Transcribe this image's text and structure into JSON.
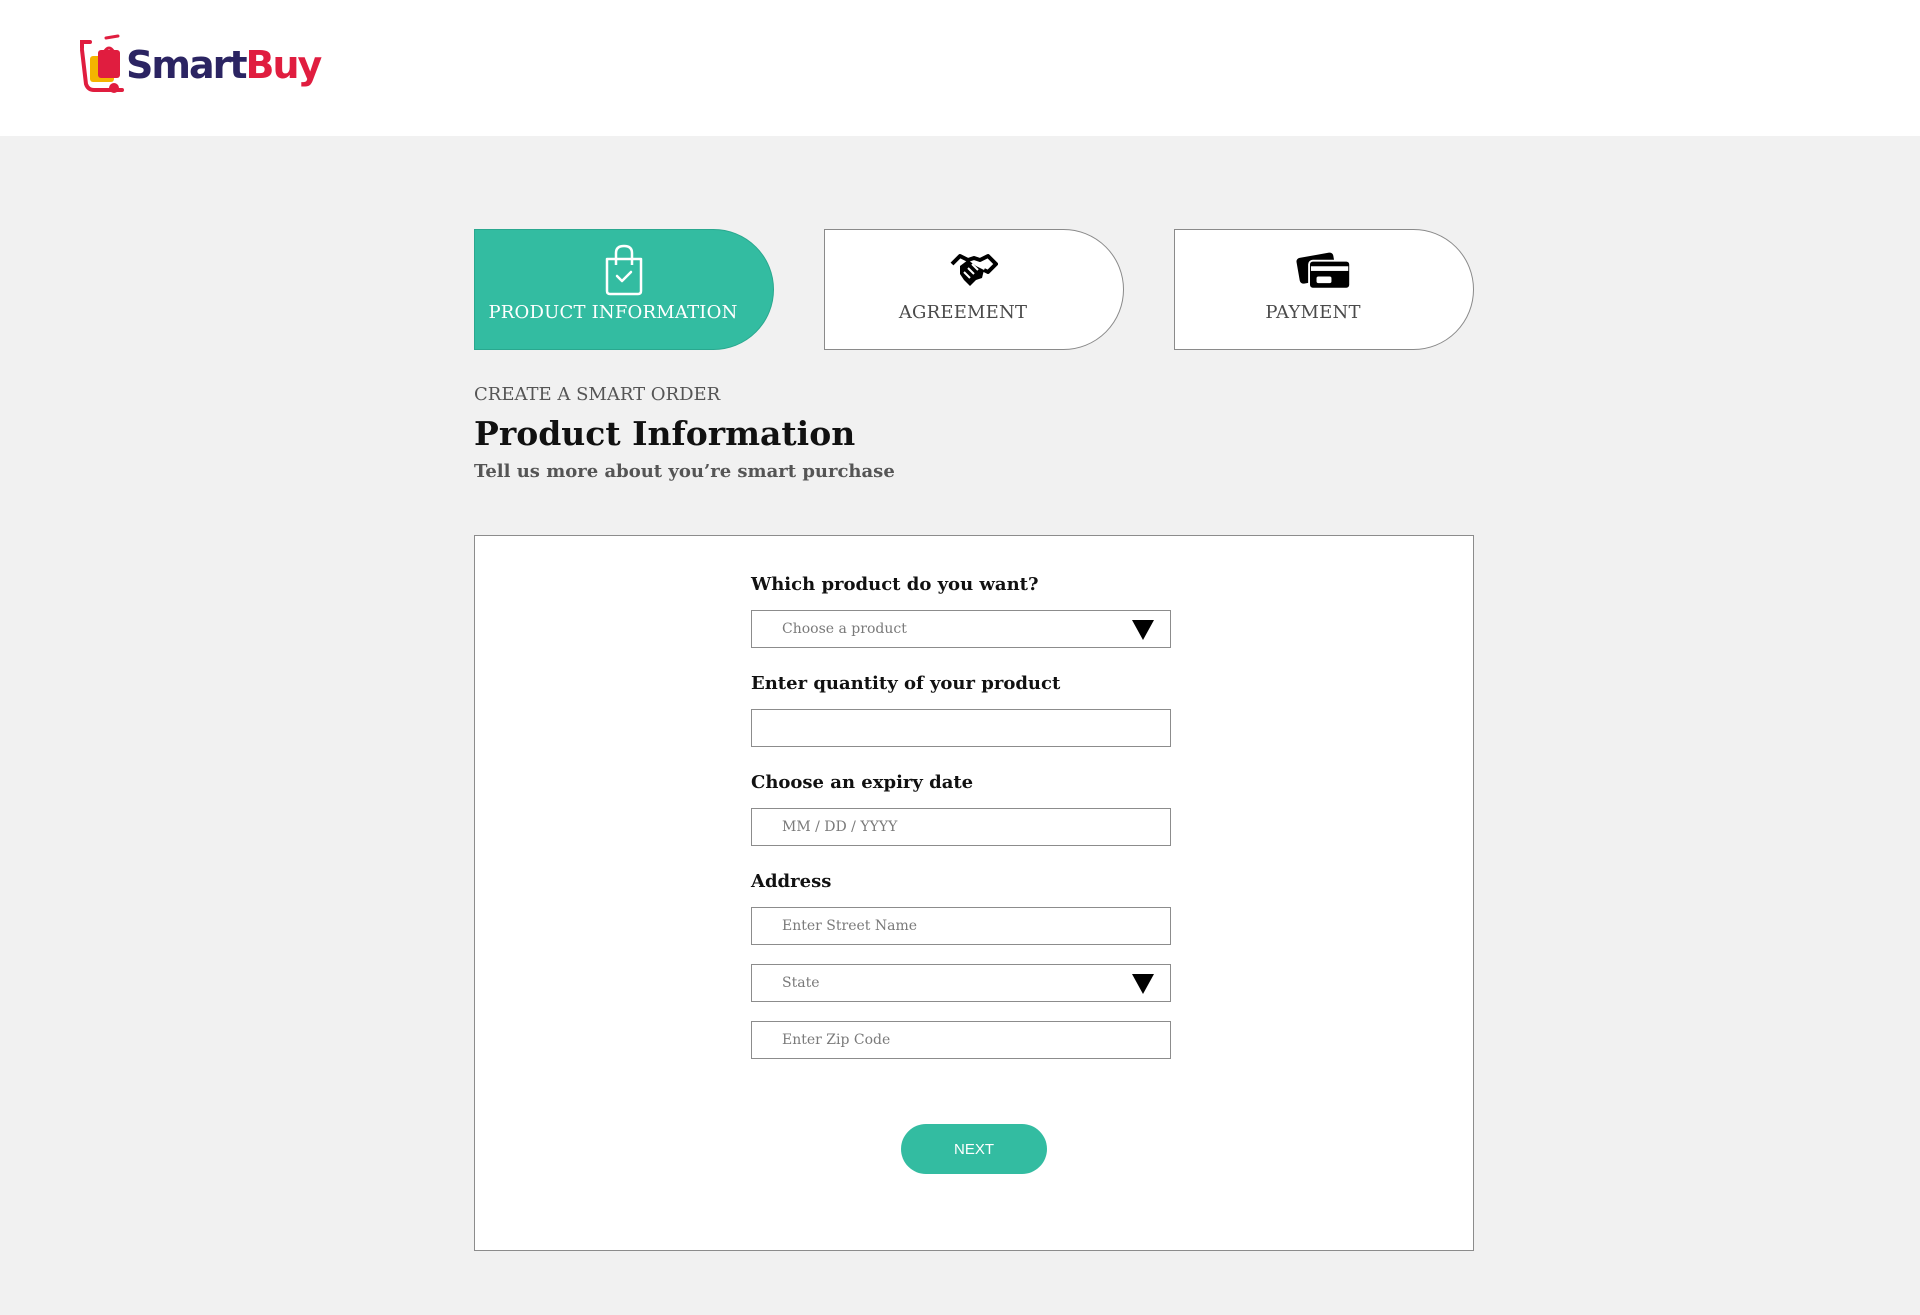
{
  "brand": {
    "name_part1": "Smart",
    "name_part2": "Buy",
    "color_dark": "#2b2462",
    "color_red": "#e01d3f",
    "icon": "shopping-cart-bag-logo-icon"
  },
  "steps": [
    {
      "label": "PRODUCT INFORMATION",
      "icon": "shopping-bag-check-icon",
      "active": true
    },
    {
      "label": "AGREEMENT",
      "icon": "handshake-icon",
      "active": false
    },
    {
      "label": "PAYMENT",
      "icon": "credit-cards-icon",
      "active": false
    }
  ],
  "header": {
    "eyebrow": "CREATE A SMART ORDER",
    "title": "Product Information",
    "subtitle": "Tell us more about you’re smart purchase"
  },
  "form": {
    "product_label": "Which product do you want?",
    "product_placeholder": "Choose a product",
    "quantity_label": "Enter quantity of your product",
    "quantity_value": "",
    "expiry_label": "Choose an expiry date",
    "expiry_placeholder": "MM / DD / YYYY",
    "address_label": "Address",
    "street_placeholder": "Enter Street Name",
    "state_placeholder": "State",
    "zip_placeholder": "Enter Zip Code",
    "next_label": "NEXT"
  },
  "colors": {
    "accent": "#33bca1",
    "page_background": "#f1f1f1"
  }
}
